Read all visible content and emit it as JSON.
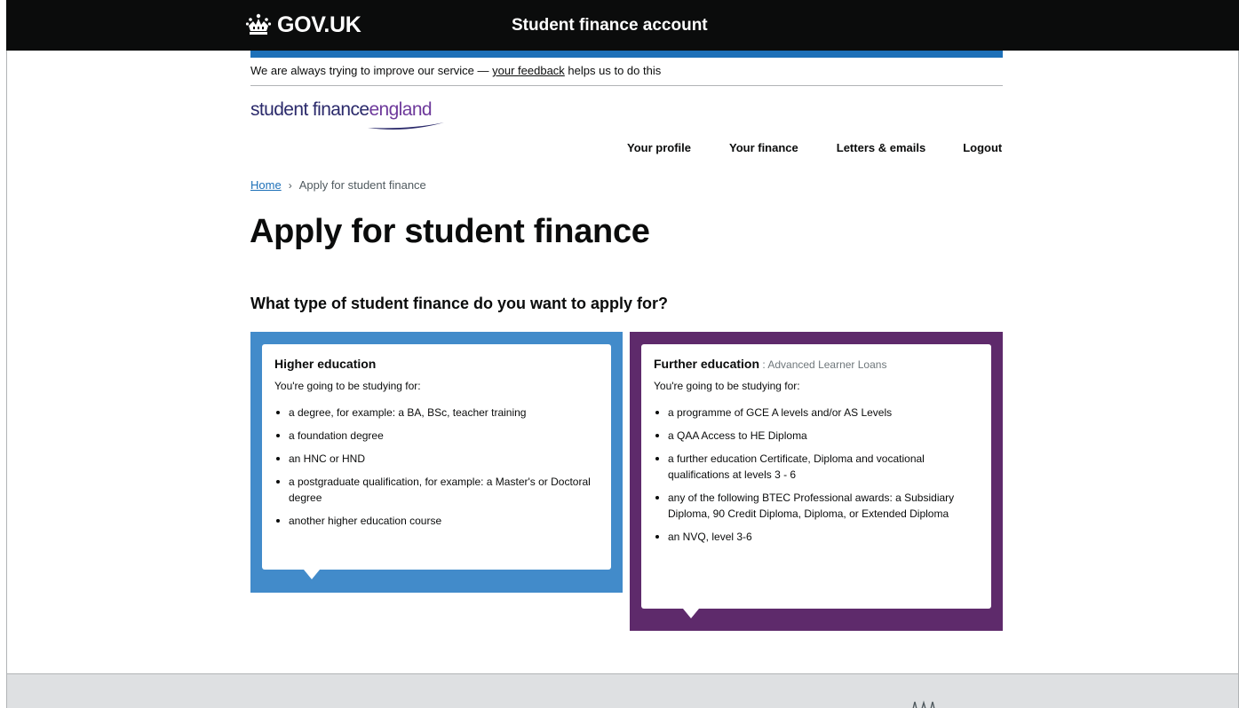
{
  "header": {
    "logo_text": "GOV.UK",
    "service_name": "Student finance account"
  },
  "feedback": {
    "prefix": "We are always trying to improve our service — ",
    "link": "your feedback",
    "suffix": " helps us to do this"
  },
  "brand": {
    "part1": "student finance",
    "part2": "england"
  },
  "nav": {
    "profile": "Your profile",
    "finance": "Your finance",
    "letters": "Letters & emails",
    "logout": "Logout"
  },
  "breadcrumb": {
    "home": "Home",
    "separator": "›",
    "current": "Apply for student finance"
  },
  "page": {
    "title": "Apply for student finance",
    "question": "What type of student finance do you want to apply for?"
  },
  "options": {
    "higher": {
      "title": "Higher education",
      "lead": "You're going to be studying for:",
      "items": [
        "a degree, for example: a BA, BSc, teacher training",
        "a foundation degree",
        "an HNC or HND",
        "a postgraduate qualification, for example: a Master's or Doctoral degree",
        "another higher education course"
      ]
    },
    "further": {
      "title": "Further education",
      "subtitle": " : Advanced Learner Loans",
      "lead": "You're going to be studying for:",
      "items": [
        "a programme of GCE A levels and/or AS Levels",
        "a QAA Access to HE Diploma",
        "a further education Certificate, Diploma and vocational qualifications at levels 3 - 6",
        "any of the following BTEC Professional awards: a Subsidiary Diploma, 90 Credit Diploma, Diploma, or Extended Diploma",
        "an NVQ, level 3-6"
      ]
    }
  },
  "colors": {
    "higher_panel": "#428bca",
    "further_panel": "#5e2a6b",
    "govuk_blue": "#1d70b8"
  }
}
